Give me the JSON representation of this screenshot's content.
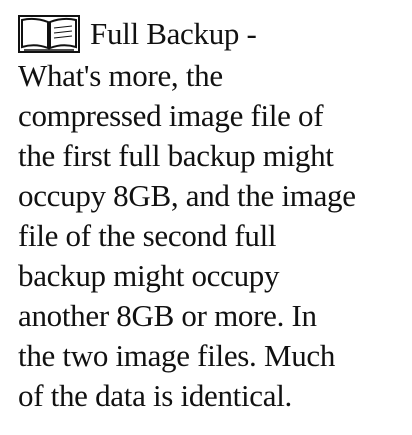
{
  "topic": {
    "icon": "open-book-icon",
    "title": "Full Backup -",
    "lines": [
      "What's more, the",
      "compressed image file of",
      "the first full backup might",
      "occupy 8GB, and the image",
      "file of the second full",
      "backup might occupy",
      "another 8GB or more. In",
      "the two image files. Much",
      "of the data is identical."
    ]
  }
}
